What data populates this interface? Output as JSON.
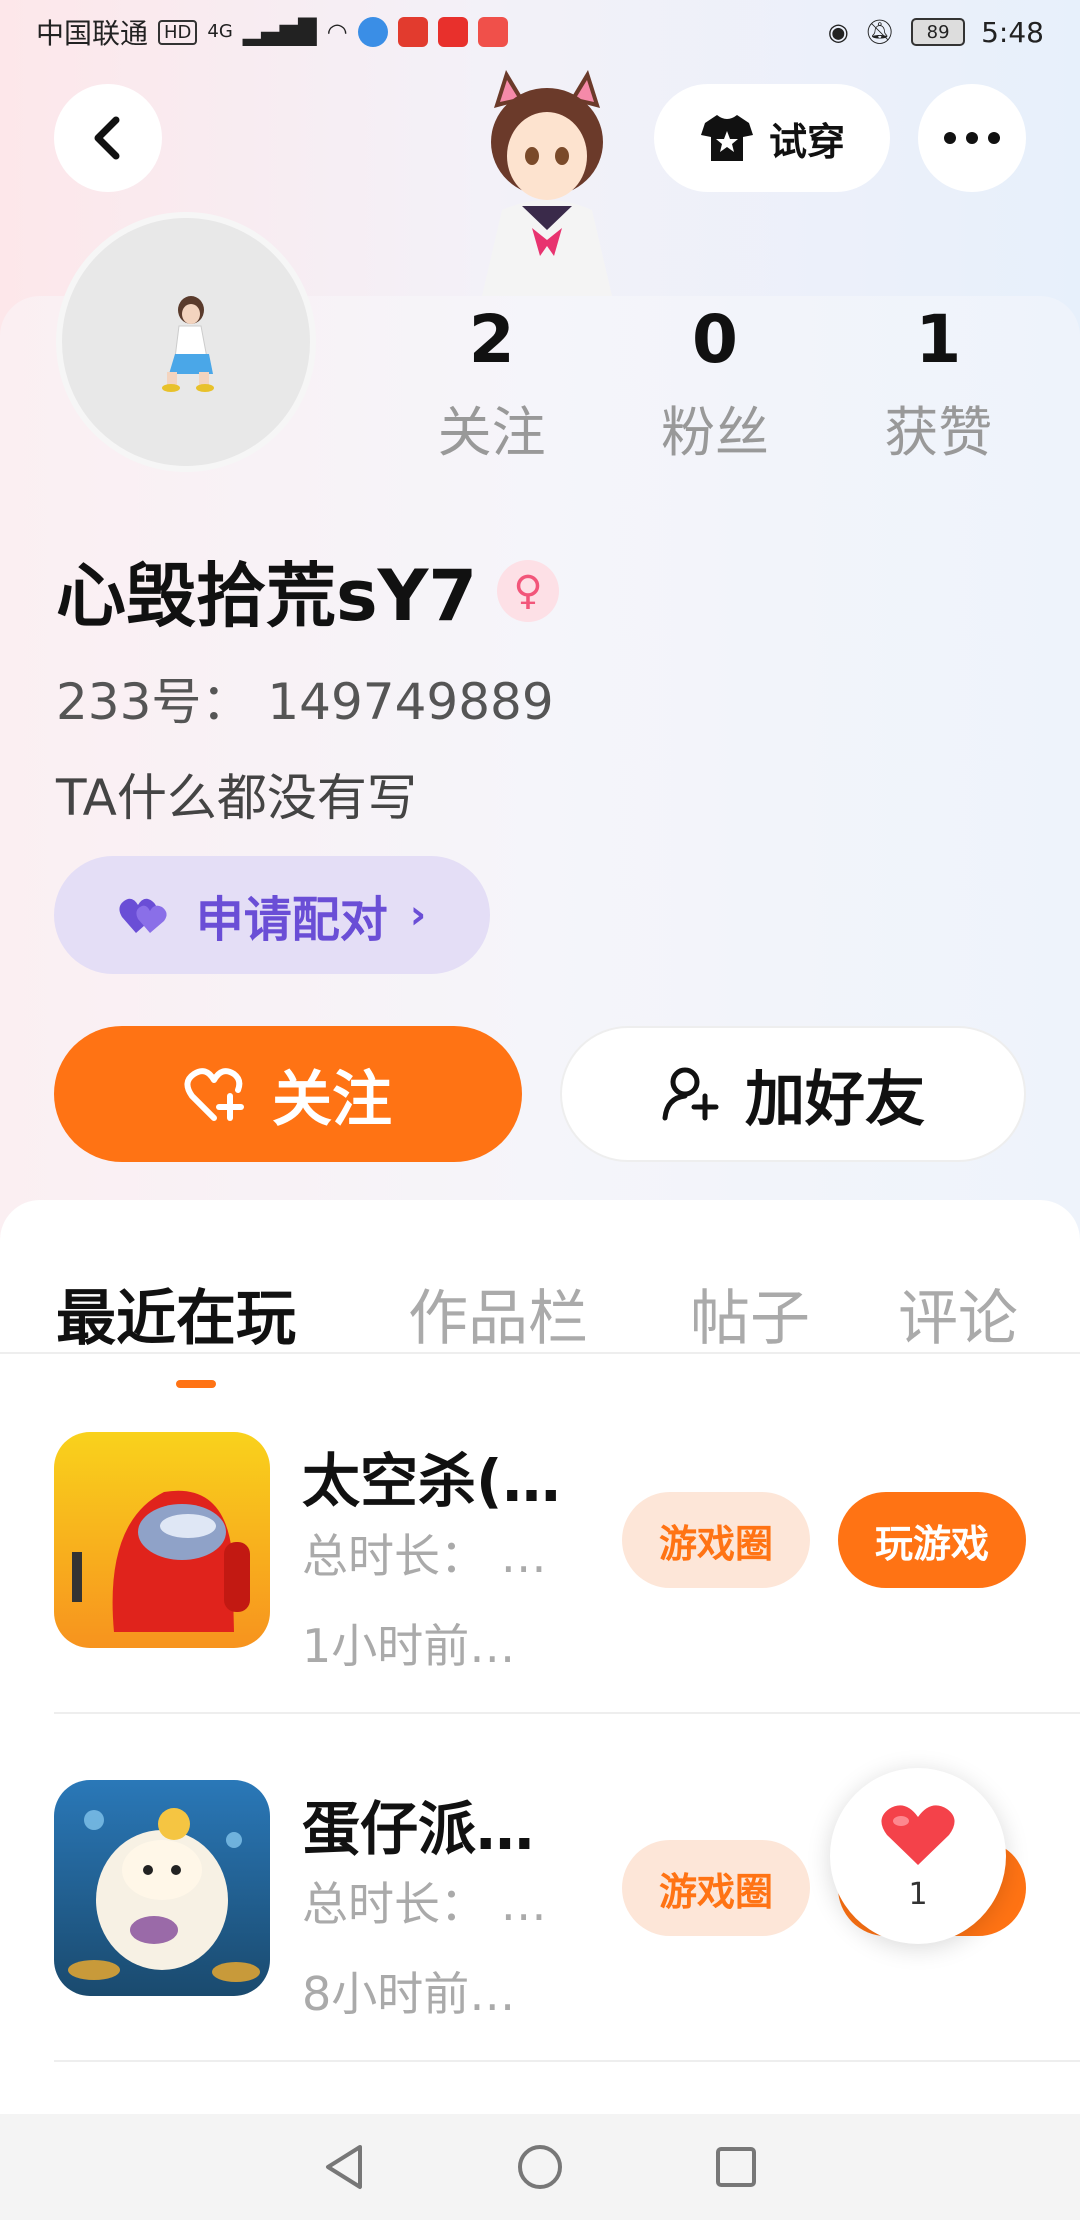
{
  "status_bar": {
    "carrier": "中国联通",
    "hd": "HD",
    "network": "4G",
    "battery": "89",
    "time": "5:48"
  },
  "header": {
    "tryon_label": "试穿"
  },
  "profile": {
    "stats": [
      {
        "value": "2",
        "label": "关注"
      },
      {
        "value": "0",
        "label": "粉丝"
      },
      {
        "value": "1",
        "label": "获赞"
      }
    ],
    "username": "心毁拾荒sY7",
    "gender_symbol": "♀",
    "uid": "233号： 149749889",
    "bio": "TA什么都没有写",
    "match_label": "申请配对",
    "follow_label": "关注",
    "add_friend_label": "加好友"
  },
  "tabs": [
    {
      "label": "最近在玩",
      "active": true
    },
    {
      "label": "作品栏",
      "active": false
    },
    {
      "label": "帖子",
      "active": false
    },
    {
      "label": "评论",
      "active": false
    }
  ],
  "games": [
    {
      "name": "太空杀(…",
      "playtime": "总时长： …",
      "last_played": "1小时前…",
      "circle_label": "游戏圈",
      "play_label": "玩游戏"
    },
    {
      "name": "蛋仔派…",
      "playtime": "总时长： …",
      "last_played": "8小时前…",
      "circle_label": "游戏圈"
    }
  ],
  "like_float": {
    "count": "1"
  },
  "colors": {
    "accent": "#ff7314",
    "match_purple": "#6a4ed6",
    "gender_pink": "#f2567a"
  }
}
